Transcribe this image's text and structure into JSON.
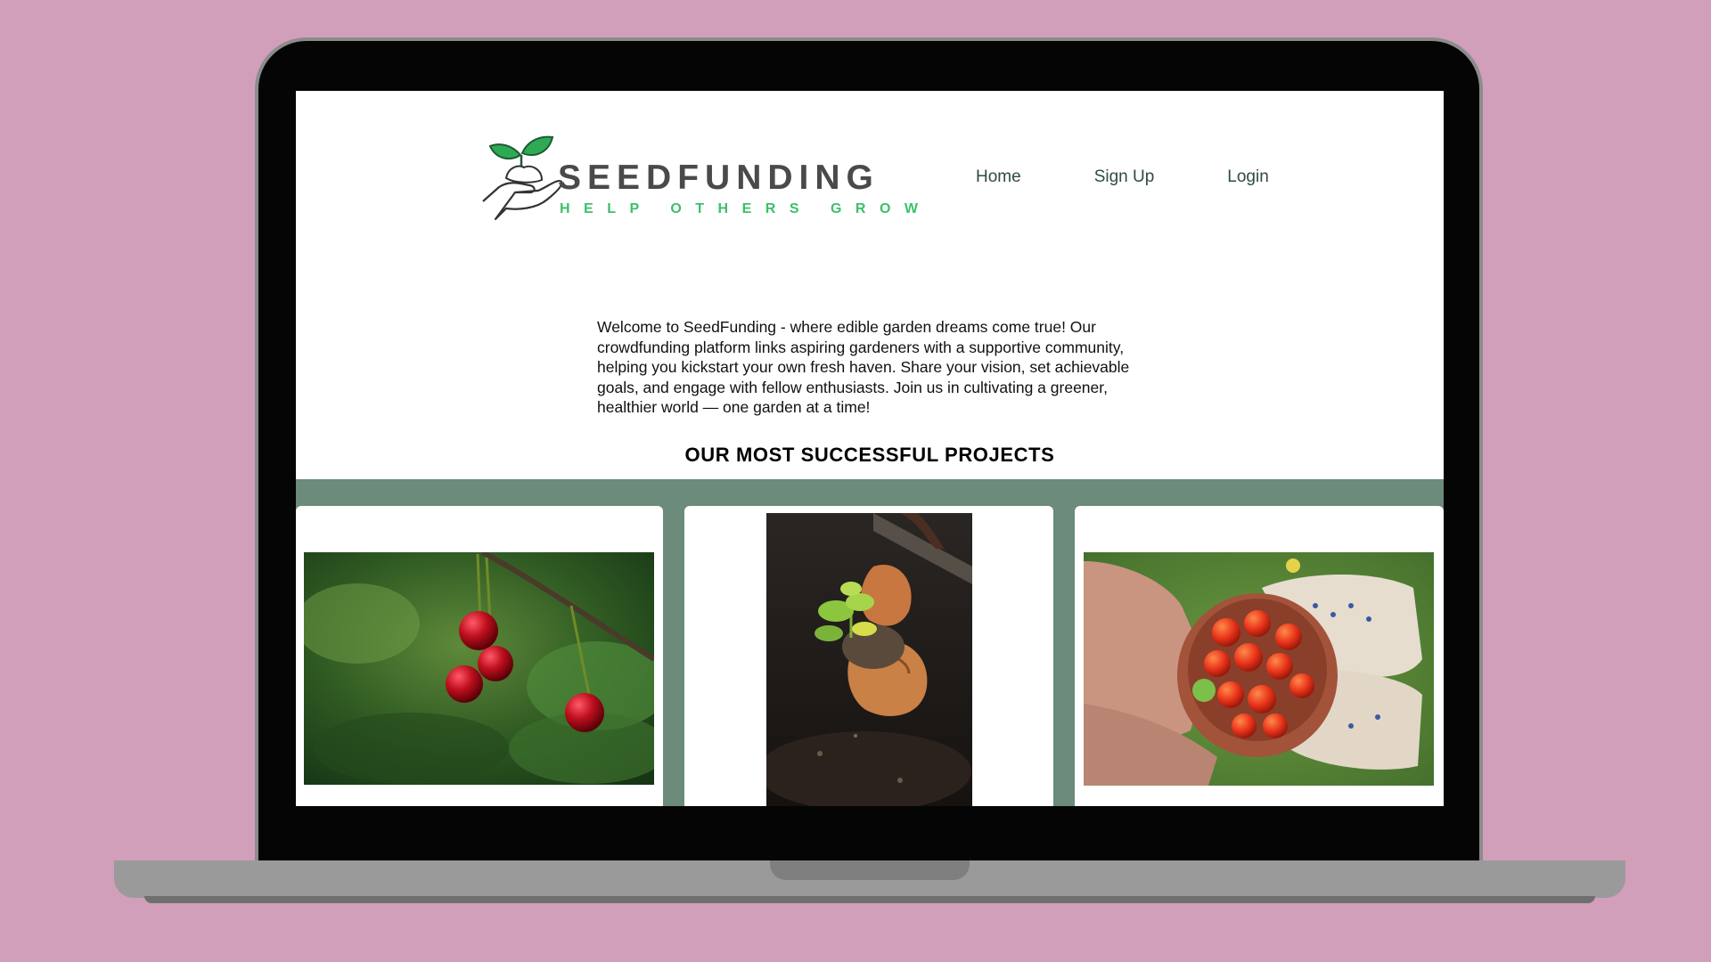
{
  "brand": {
    "name": "SEEDFUNDING",
    "tagline": "HELP OTHERS GROW"
  },
  "nav": {
    "items": [
      {
        "label": "Home"
      },
      {
        "label": "Sign Up"
      },
      {
        "label": "Login"
      }
    ]
  },
  "intro": {
    "text": "Welcome to SeedFunding - where edible garden dreams come true! Our crowdfunding platform links aspiring gardeners with a supportive community, helping you kickstart your own fresh haven. Share your vision, set achievable goals, and engage with fellow enthusiasts. Join us in cultivating a greener, healthier world — one garden at a time!"
  },
  "projects": {
    "title": "OUR MOST SUCCESSFUL PROJECTS"
  },
  "colors": {
    "background": "#d29fba",
    "band": "#6c8b7a",
    "brand_green": "#3cc06a",
    "nav_text": "#2f4a44"
  },
  "icons": {
    "logo": "hand-holding-seedling-icon"
  }
}
